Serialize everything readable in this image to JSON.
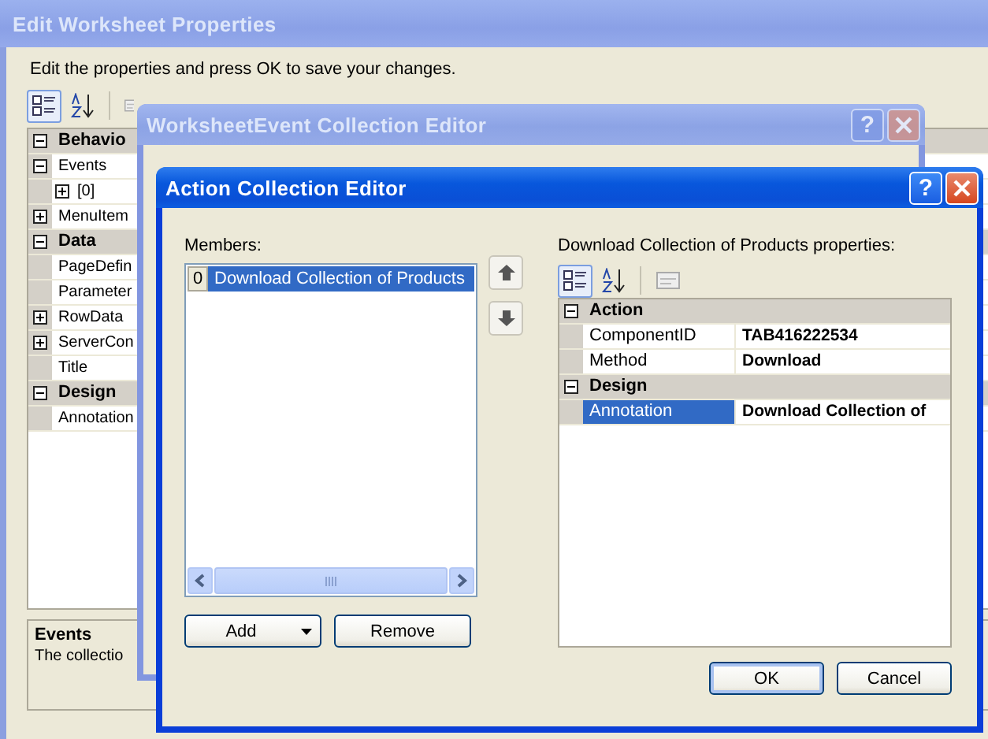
{
  "back_window": {
    "title": "Edit Worksheet Properties",
    "instruction": "Edit the properties and press OK to save your changes.",
    "toolbar": [
      {
        "kind": "categorized",
        "selected": true
      },
      {
        "kind": "alphabetical",
        "selected": false
      },
      {
        "kind": "pages",
        "selected": false
      }
    ],
    "property_grid": {
      "rows": [
        {
          "kind": "category",
          "label": "Behavio",
          "expanded": true,
          "children": [
            {
              "kind": "property",
              "label": "Events",
              "expanded": true,
              "children": [
                {
                  "kind": "property",
                  "label": "[0]",
                  "expanded": false
                }
              ]
            },
            {
              "kind": "property",
              "label": "MenuItem",
              "expanded": false
            }
          ]
        },
        {
          "kind": "category",
          "label": "Data",
          "expanded": true,
          "children": [
            {
              "kind": "property",
              "label": "PageDefin"
            },
            {
              "kind": "property",
              "label": "Parameter"
            },
            {
              "kind": "property",
              "label": "RowData",
              "expanded": false
            },
            {
              "kind": "property",
              "label": "ServerCon",
              "expanded": false
            },
            {
              "kind": "property",
              "label": "Title"
            }
          ]
        },
        {
          "kind": "category",
          "label": "Design",
          "expanded": true,
          "children": [
            {
              "kind": "property",
              "label": "Annotation"
            }
          ]
        }
      ]
    },
    "description": {
      "title": "Events",
      "text": "The collectio"
    }
  },
  "middle_window": {
    "title": "WorksheetEvent Collection Editor",
    "help": "?"
  },
  "front_window": {
    "title": "Action Collection Editor",
    "help": "?",
    "members_label": "Members:",
    "members": [
      {
        "index": "0",
        "label": "Download Collection of Products",
        "selected": true
      }
    ],
    "add_button": "Add",
    "remove_button": "Remove",
    "properties_label": "Download Collection of Products properties:",
    "toolbar": [
      {
        "kind": "categorized",
        "selected": true
      },
      {
        "kind": "alphabetical",
        "selected": false
      },
      {
        "kind": "pages",
        "selected": false
      }
    ],
    "property_grid": {
      "rows": [
        {
          "kind": "category",
          "label": "Action",
          "expanded": true,
          "children": [
            {
              "kind": "property",
              "label": "ComponentID",
              "value": "TAB416222534",
              "selected": false
            },
            {
              "kind": "property",
              "label": "Method",
              "value": "Download",
              "selected": false
            }
          ]
        },
        {
          "kind": "category",
          "label": "Design",
          "expanded": true,
          "children": [
            {
              "kind": "property",
              "label": "Annotation",
              "value": "Download Collection of",
              "selected": true
            }
          ]
        }
      ]
    },
    "ok_button": "OK",
    "cancel_button": "Cancel"
  }
}
